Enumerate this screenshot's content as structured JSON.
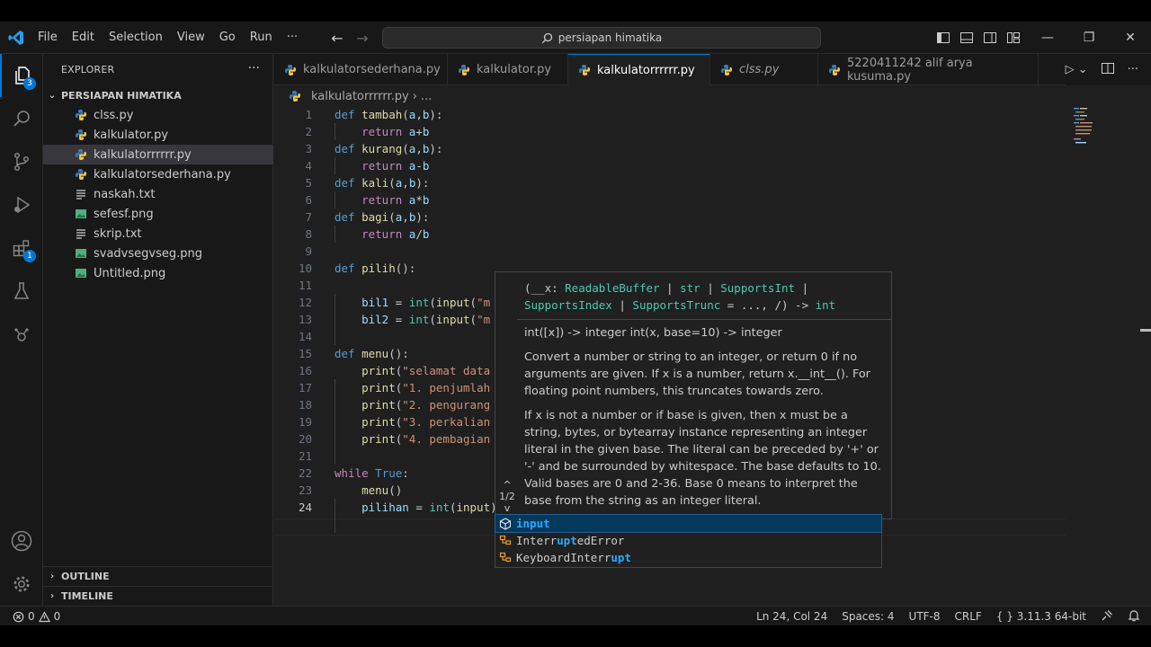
{
  "menu": [
    "File",
    "Edit",
    "Selection",
    "View",
    "Go",
    "Run",
    "···"
  ],
  "command_center": "persiapan himatika",
  "explorer": {
    "title": "EXPLORER",
    "more": "···",
    "folder": "PERSIAPAN HIMATIKA",
    "files": [
      {
        "name": "clss.py",
        "icon": "python-icon"
      },
      {
        "name": "kalkulator.py",
        "icon": "python-icon"
      },
      {
        "name": "kalkulatorrrrrr.py",
        "icon": "python-icon",
        "selected": true
      },
      {
        "name": "kalkulatorsederhana.py",
        "icon": "python-icon"
      },
      {
        "name": "naskah.txt",
        "icon": "text-file-icon"
      },
      {
        "name": "sefesf.png",
        "icon": "image-file-icon"
      },
      {
        "name": "skrip.txt",
        "icon": "text-file-icon"
      },
      {
        "name": "svadvsegvseg.png",
        "icon": "image-file-icon"
      },
      {
        "name": "Untitled.png",
        "icon": "image-file-icon"
      }
    ],
    "outline": "OUTLINE",
    "timeline": "TIMELINE"
  },
  "activity_badges": {
    "explorer": "3",
    "extensions": "1"
  },
  "tabs": [
    {
      "label": "kalkulatorsederhana.py",
      "modified": true
    },
    {
      "label": "kalkulator.py",
      "modified": true
    },
    {
      "label": "kalkulatorrrrrr.py",
      "modified": true,
      "active": true
    },
    {
      "label": "clss.py",
      "italic": true
    },
    {
      "label": "5220411242 alif arya kusuma.py"
    }
  ],
  "breadcrumb": {
    "file": "kalkulatorrrrrr.py",
    "rest": "..."
  },
  "code_lines": [
    {
      "n": "1"
    },
    {
      "n": "2"
    },
    {
      "n": "3"
    },
    {
      "n": "4"
    },
    {
      "n": "5"
    },
    {
      "n": "6"
    },
    {
      "n": "7"
    },
    {
      "n": "8"
    },
    {
      "n": "9"
    },
    {
      "n": "10"
    },
    {
      "n": "11"
    },
    {
      "n": "12"
    },
    {
      "n": "13"
    },
    {
      "n": "14"
    },
    {
      "n": "15"
    },
    {
      "n": "16"
    },
    {
      "n": "17"
    },
    {
      "n": "18"
    },
    {
      "n": "19"
    },
    {
      "n": "20"
    },
    {
      "n": "21"
    },
    {
      "n": "22"
    },
    {
      "n": "23"
    },
    {
      "n": "24"
    }
  ],
  "code": {
    "l1": [
      "def",
      "tambah",
      "(",
      "a",
      ",",
      "b",
      "):"
    ],
    "l2": [
      "return",
      "a",
      "+",
      "b"
    ],
    "l3": [
      "def",
      "kurang",
      "(",
      "a",
      ",",
      "b",
      "):"
    ],
    "l4": [
      "return",
      "a",
      "-",
      "b"
    ],
    "l5": [
      "def",
      "kali",
      "(",
      "a",
      ",",
      "b",
      "):"
    ],
    "l6": [
      "return",
      "a",
      "*",
      "b"
    ],
    "l7": [
      "def",
      "bagi",
      "(",
      "a",
      ",",
      "b",
      "):"
    ],
    "l8": [
      "return",
      "a",
      "/",
      "b"
    ],
    "l10": [
      "def",
      "pilih",
      "():"
    ],
    "l12": [
      "bil1",
      " = ",
      "int",
      "(",
      "input",
      "(",
      "\"m"
    ],
    "l13": [
      "bil2",
      " = ",
      "int",
      "(",
      "input",
      "(",
      "\"m"
    ],
    "l15": [
      "def",
      "menu",
      "():"
    ],
    "l16": [
      "print",
      "(",
      "\"selamat data"
    ],
    "l17": [
      "print",
      "(",
      "\"1. penjumlah"
    ],
    "l18": [
      "print",
      "(",
      "\"2. pengurang"
    ],
    "l19": [
      "print",
      "(",
      "\"3. perkalian"
    ],
    "l20": [
      "print",
      "(",
      "\"4. pembagian"
    ],
    "l22": [
      "while",
      "True",
      ":"
    ],
    "l23": [
      "menu",
      "()"
    ],
    "l24": [
      "pilihan",
      " = ",
      "int",
      "(",
      "input",
      ")"
    ]
  },
  "hover": {
    "sig1_a": "(__x: ",
    "sig1_b": "ReadableBuffer",
    "sig1_c": " | ",
    "sig1_d": "str",
    "sig1_e": " | ",
    "sig1_f": "SupportsInt",
    "sig1_g": " |",
    "sig2_a": "SupportsIndex",
    "sig2_b": " | ",
    "sig2_c": "SupportsTrunc",
    "sig2_d": " = ..., /) -> ",
    "sig2_e": "int",
    "doc1": "int([x]) -> integer int(x, base=10) -> integer",
    "doc2": "Convert a number or string to an integer, or return 0 if no arguments are given. If x is a number, return x.__int__(). For floating point numbers, this truncates towards zero.",
    "doc3": "If x is not a number or if base is given, then x must be a string, bytes, or bytearray instance representing an integer literal in the given base. The literal can be preceded by '+' or '-' and be surrounded by whitespace. The base defaults to 10. Valid bases are 0 and 2-36. Base 0 means to interpret the base from the string as an integer literal.",
    "nav": "1/2",
    "nav_up": "^",
    "nav_down": "v"
  },
  "suggestions": [
    {
      "pre": "",
      "hl": "input",
      "post": "",
      "icon": "cube-icon",
      "selected": true
    },
    {
      "pre": "Interr",
      "hl": "upt",
      "post": "edError",
      "icon": "class-icon"
    },
    {
      "pre": "KeyboardInterr",
      "hl": "upt",
      "post": "",
      "icon": "class-icon"
    }
  ],
  "status": {
    "errors": "0",
    "warnings": "0",
    "position": "Ln 24, Col 24",
    "spaces": "Spaces: 4",
    "encoding": "UTF-8",
    "eol": "CRLF",
    "python": "3.11.3 64-bit"
  },
  "colors": {
    "accent": "#0078d4",
    "keyword": "#569cd6",
    "function": "#dcdcaa",
    "param": "#9cdcfe",
    "string": "#ce9178"
  }
}
